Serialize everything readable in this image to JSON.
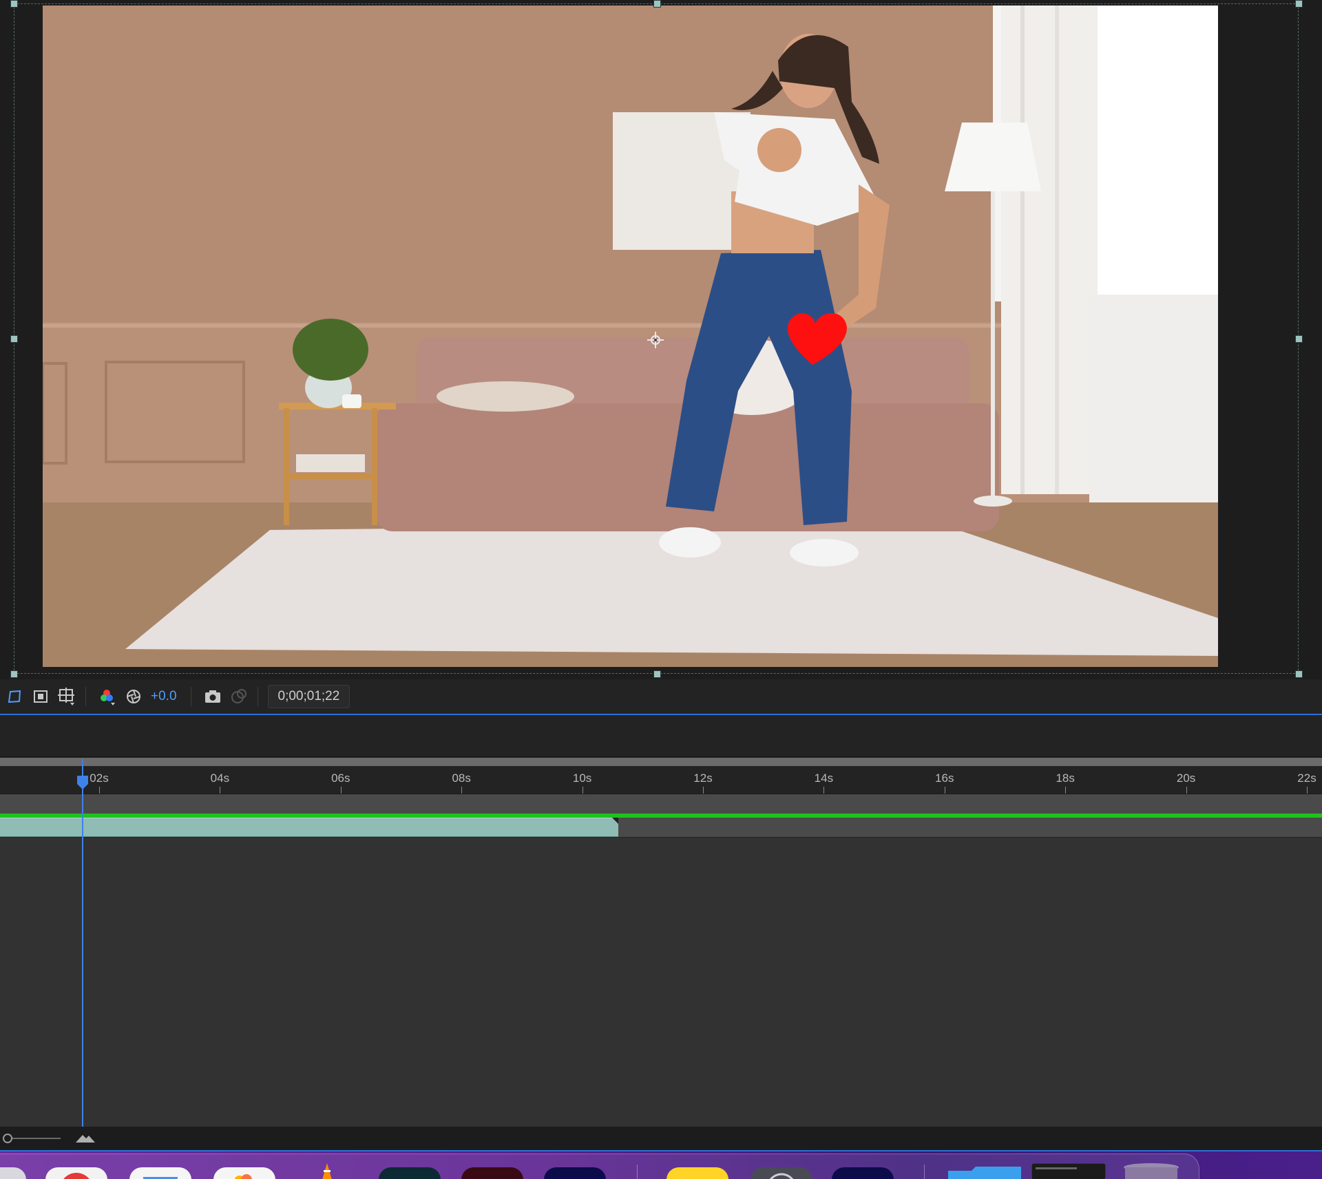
{
  "viewer": {
    "exposure_value": "+0.0",
    "timecode": "0;00;01;22"
  },
  "timeline": {
    "ruler_labels": [
      "02s",
      "04s",
      "06s",
      "08s",
      "10s",
      "12s",
      "14s",
      "16s",
      "18s",
      "20s",
      "22s"
    ],
    "playhead_time_seconds": 1.73,
    "layer_end_seconds": 10.6
  },
  "icons": {
    "toolbar": [
      "toggle-mask-icon",
      "region-of-interest-icon",
      "transparency-grid-icon",
      "color-channels-icon",
      "exposure-reset-icon",
      "snapshot-camera-icon",
      "show-snapshot-icon"
    ],
    "dock": [
      "app-icon",
      "chrome-icon",
      "mail-icon",
      "photos-icon",
      "vlc-icon",
      "after-effects-icon",
      "media-encoder-icon",
      "premiere-icon",
      "notes-icon",
      "system-icon",
      "photoshop-icon",
      "folder-icon",
      "window-thumbnail-icon",
      "trash-icon"
    ]
  },
  "colors": {
    "accent_blue": "#3f82e8",
    "exposure_blue": "#4f9dff",
    "layer_bar": "#8fbcb4",
    "render_green": "#1dc21d",
    "heart_red": "#ff1010"
  }
}
